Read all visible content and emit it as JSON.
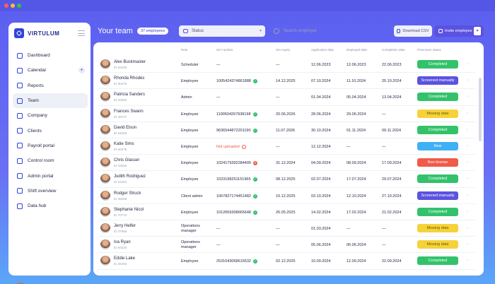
{
  "brand": {
    "name": "VIRTULUM"
  },
  "sidebar": {
    "items": [
      {
        "label": "Dashboard",
        "icon": "grid-icon"
      },
      {
        "label": "Calendar",
        "icon": "calendar-icon",
        "has_add": true
      },
      {
        "label": "Reports",
        "icon": "document-icon"
      },
      {
        "label": "Team",
        "icon": "team-icon",
        "active": true
      },
      {
        "label": "Company",
        "icon": "building-icon"
      },
      {
        "label": "Clients",
        "icon": "clients-icon"
      },
      {
        "label": "Payroll portal",
        "icon": "payroll-icon"
      },
      {
        "label": "Control room",
        "icon": "control-icon"
      },
      {
        "label": "Admin portal",
        "icon": "admin-icon"
      },
      {
        "label": "Shift overview",
        "icon": "shift-icon"
      },
      {
        "label": "Data hub",
        "icon": "data-icon"
      }
    ],
    "add_symbol": "+"
  },
  "header": {
    "title": "Your team",
    "count_badge": "37 employees",
    "status_placeholder": "Status",
    "search_placeholder": "Search employee",
    "download_label": "Download CSV",
    "invite_label": "Invite employee"
  },
  "table": {
    "columns": [
      "Role",
      "SIA number",
      "SIA expiry",
      "Application date",
      "Deployed date",
      "Completion date",
      "Prescreen status"
    ],
    "rows": [
      {
        "name": "Alex Buckmaster",
        "id": "ID 94330",
        "role": "Scheduler",
        "sia": "—",
        "sia_state": "none",
        "expiry": "—",
        "app": "12.06.2023",
        "dep": "12.06.2023",
        "comp": "22.06.2023",
        "status": "Completed",
        "color": "#33c26b"
      },
      {
        "name": "Rhonda Rhodes",
        "id": "ID 60478",
        "role": "Employee",
        "sia": "1005424374861888",
        "sia_state": "ok",
        "expiry": "14.12.2025",
        "app": "07.10.2024",
        "dep": "11.10.2024",
        "comp": "25.10.2024",
        "status": "Screened manually",
        "color": "#5b52e0"
      },
      {
        "name": "Patricia Sanders",
        "id": "ID 26492",
        "role": "Admin",
        "sia": "—",
        "sia_state": "none",
        "expiry": "—",
        "app": "01.04.2024",
        "dep": "05.04.2024",
        "comp": "13.04.2024",
        "status": "Completed",
        "color": "#33c26b"
      },
      {
        "name": "Frances Swann",
        "id": "ID 36727",
        "role": "Employee",
        "sia": "1190504267938198",
        "sia_state": "ok",
        "expiry": "20.06.2026",
        "app": "28.06.2024",
        "dep": "29.06.2024",
        "comp": "—",
        "status": "Missing data",
        "color": "#f6d23a"
      },
      {
        "name": "David Elson",
        "id": "ID 61600",
        "role": "Employee",
        "sia": "9636544872201190",
        "sia_state": "ok",
        "expiry": "11.07.2026",
        "app": "30.10.2024",
        "dep": "01.11.2024",
        "comp": "09.11.2024",
        "status": "Completed",
        "color": "#33c26b"
      },
      {
        "name": "Katie Sims",
        "id": "ID 60478",
        "role": "Employee",
        "sia": "Not uploaded",
        "sia_state": "missing",
        "expiry": "—",
        "app": "12.12.2024",
        "dep": "—",
        "comp": "—",
        "status": "New",
        "color": "#3fb0f5"
      },
      {
        "name": "Chris Glasser",
        "id": "ID 15926",
        "role": "Employee",
        "sia": "1024179392284400",
        "sia_state": "bad",
        "expiry": "31.12.2024",
        "app": "04.09.2024",
        "dep": "08.09.2024",
        "comp": "17.09.2024",
        "status": "Non license",
        "color": "#f05a4a"
      },
      {
        "name": "Judith Rodriguez",
        "id": "ID 61252",
        "role": "Employee",
        "sia": "1023198251151965",
        "sia_state": "ok",
        "expiry": "08.12.2025",
        "app": "02.07.2024",
        "dep": "17.07.2024",
        "comp": "29.07.2024",
        "status": "Completed",
        "color": "#33c26b"
      },
      {
        "name": "Rodger Struck",
        "id": "ID 38296",
        "role": "Client admin",
        "sia": "1067827174451482",
        "sia_state": "ok",
        "expiry": "10.12.2025",
        "app": "03.10.2024",
        "dep": "12.10.2024",
        "comp": "27.10.2024",
        "status": "Screened manually",
        "color": "#5b52e0"
      },
      {
        "name": "Stephanie Nicol",
        "id": "ID 70770",
        "role": "Employee",
        "sia": "1012659308665648",
        "sia_state": "ok",
        "expiry": "26.05.2025",
        "app": "14.02.2024",
        "dep": "17.02.2024",
        "comp": "21.02.2024",
        "status": "Completed",
        "color": "#33c26b"
      },
      {
        "name": "Jerry Helfer",
        "id": "ID 27886",
        "role": "Operations manager",
        "sia": "—",
        "sia_state": "none",
        "expiry": "—",
        "app": "01.03.2024",
        "dep": "—",
        "comp": "—",
        "status": "Missing data",
        "color": "#f6d23a"
      },
      {
        "name": "Iva Ryan",
        "id": "ID 94330",
        "role": "Operations manager",
        "sia": "—",
        "sia_state": "none",
        "expiry": "—",
        "app": "05.06.2024",
        "dep": "06.06.2024",
        "comp": "—",
        "status": "Missing data",
        "color": "#f6d23a"
      },
      {
        "name": "Eddie Lake",
        "id": "ID 26492",
        "role": "Employee",
        "sia": "2531043068615532",
        "sia_state": "ok",
        "expiry": "02.12.2025",
        "app": "10.09.2024",
        "dep": "12.09.2024",
        "comp": "22.09.2024",
        "status": "Completed",
        "color": "#33c26b"
      }
    ]
  }
}
